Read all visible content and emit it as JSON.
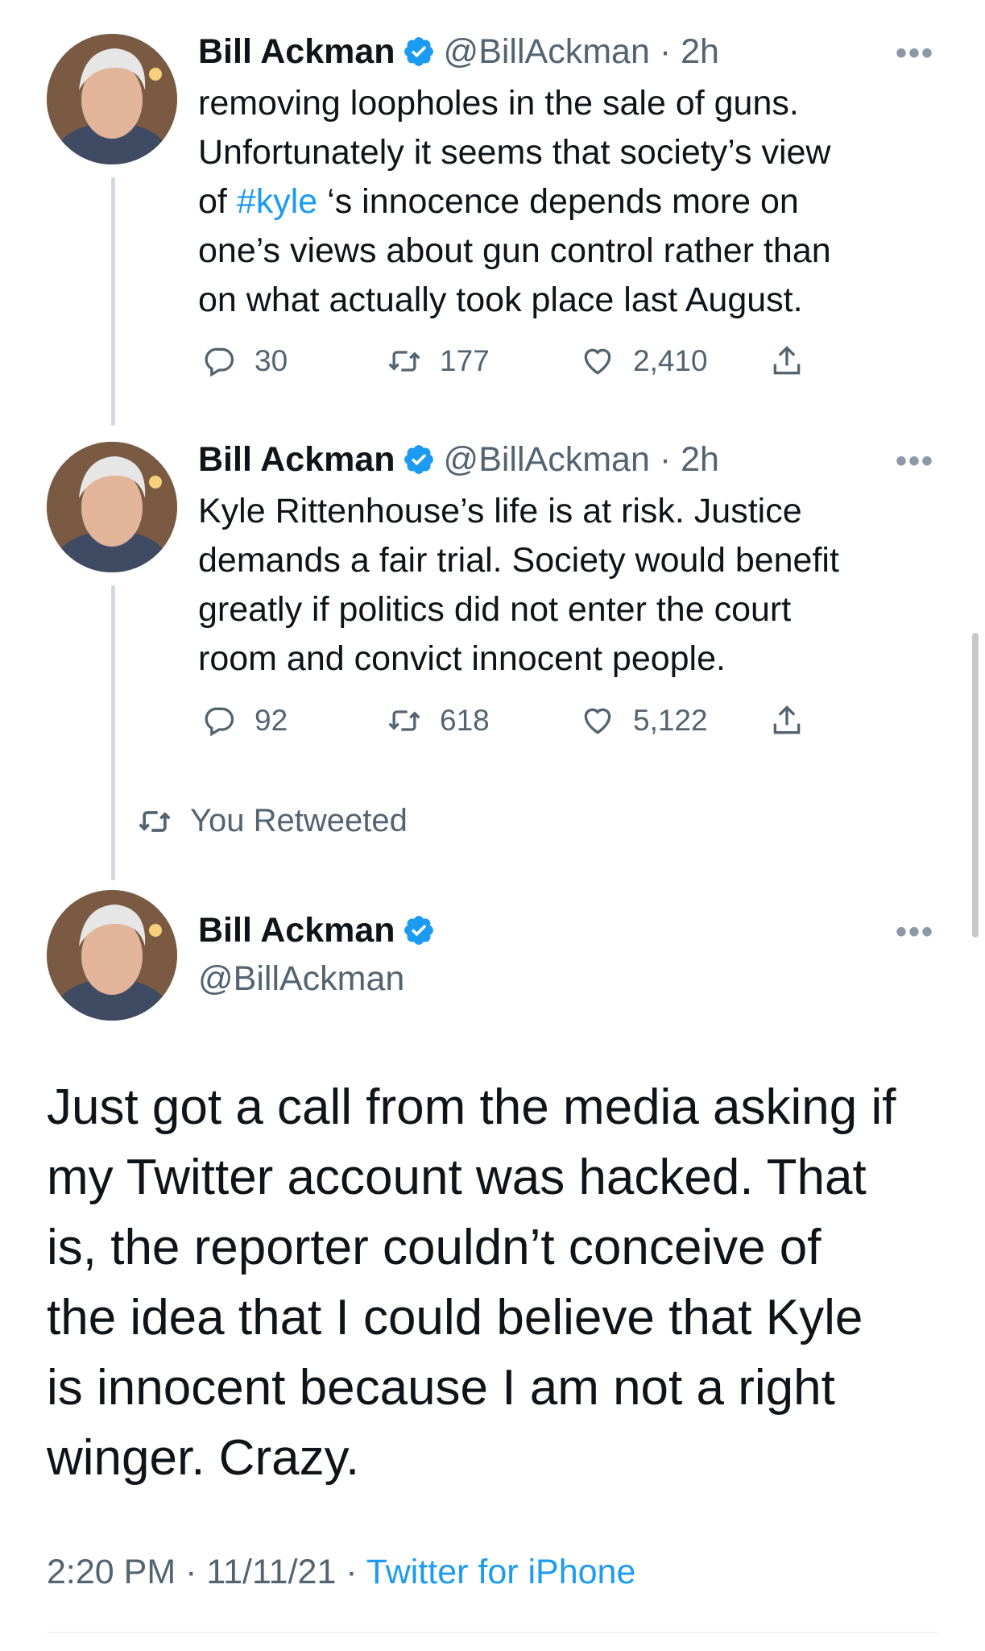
{
  "thread": [
    {
      "name": "Bill Ackman",
      "handle": "@BillAckman",
      "time": "2h",
      "more": "•••",
      "text_lines": [
        "removing loopholes in the sale of guns.",
        "Unfortunately it seems that society’s view",
        [
          "of ",
          "#kyle",
          " ‘s innocence depends more on"
        ],
        "one’s views about gun control rather than",
        "on what actually took place last August."
      ],
      "replies": "30",
      "retweets": "177",
      "likes": "2,410"
    },
    {
      "name": "Bill Ackman",
      "handle": "@BillAckman",
      "time": "2h",
      "more": "•••",
      "text_lines": [
        "Kyle Rittenhouse’s life is at risk. Justice",
        "demands a fair trial. Society would benefit",
        "greatly if politics did not enter the court",
        "room and convict innocent people."
      ],
      "replies": "92",
      "retweets": "618",
      "likes": "5,122"
    }
  ],
  "retweet_notice": "You Retweeted",
  "main_tweet": {
    "name": "Bill Ackman",
    "handle": "@BillAckman",
    "more": "•••",
    "text_lines": [
      "Just got a call from the media asking if",
      "my Twitter account was hacked. That",
      "is, the reporter couldn’t conceive of",
      "the idea that I could believe that Kyle",
      "is innocent because I am not a right",
      "winger. Crazy."
    ],
    "time": "2:20 PM",
    "date": "11/11/21",
    "source": "Twitter for iPhone"
  },
  "colors": {
    "accent": "#1d9bf0",
    "secondary_text": "#536471",
    "thread_line": "#cfd9de"
  },
  "icons": [
    "verified-badge-icon",
    "reply-icon",
    "retweet-icon",
    "like-icon",
    "share-icon",
    "more-icon"
  ]
}
